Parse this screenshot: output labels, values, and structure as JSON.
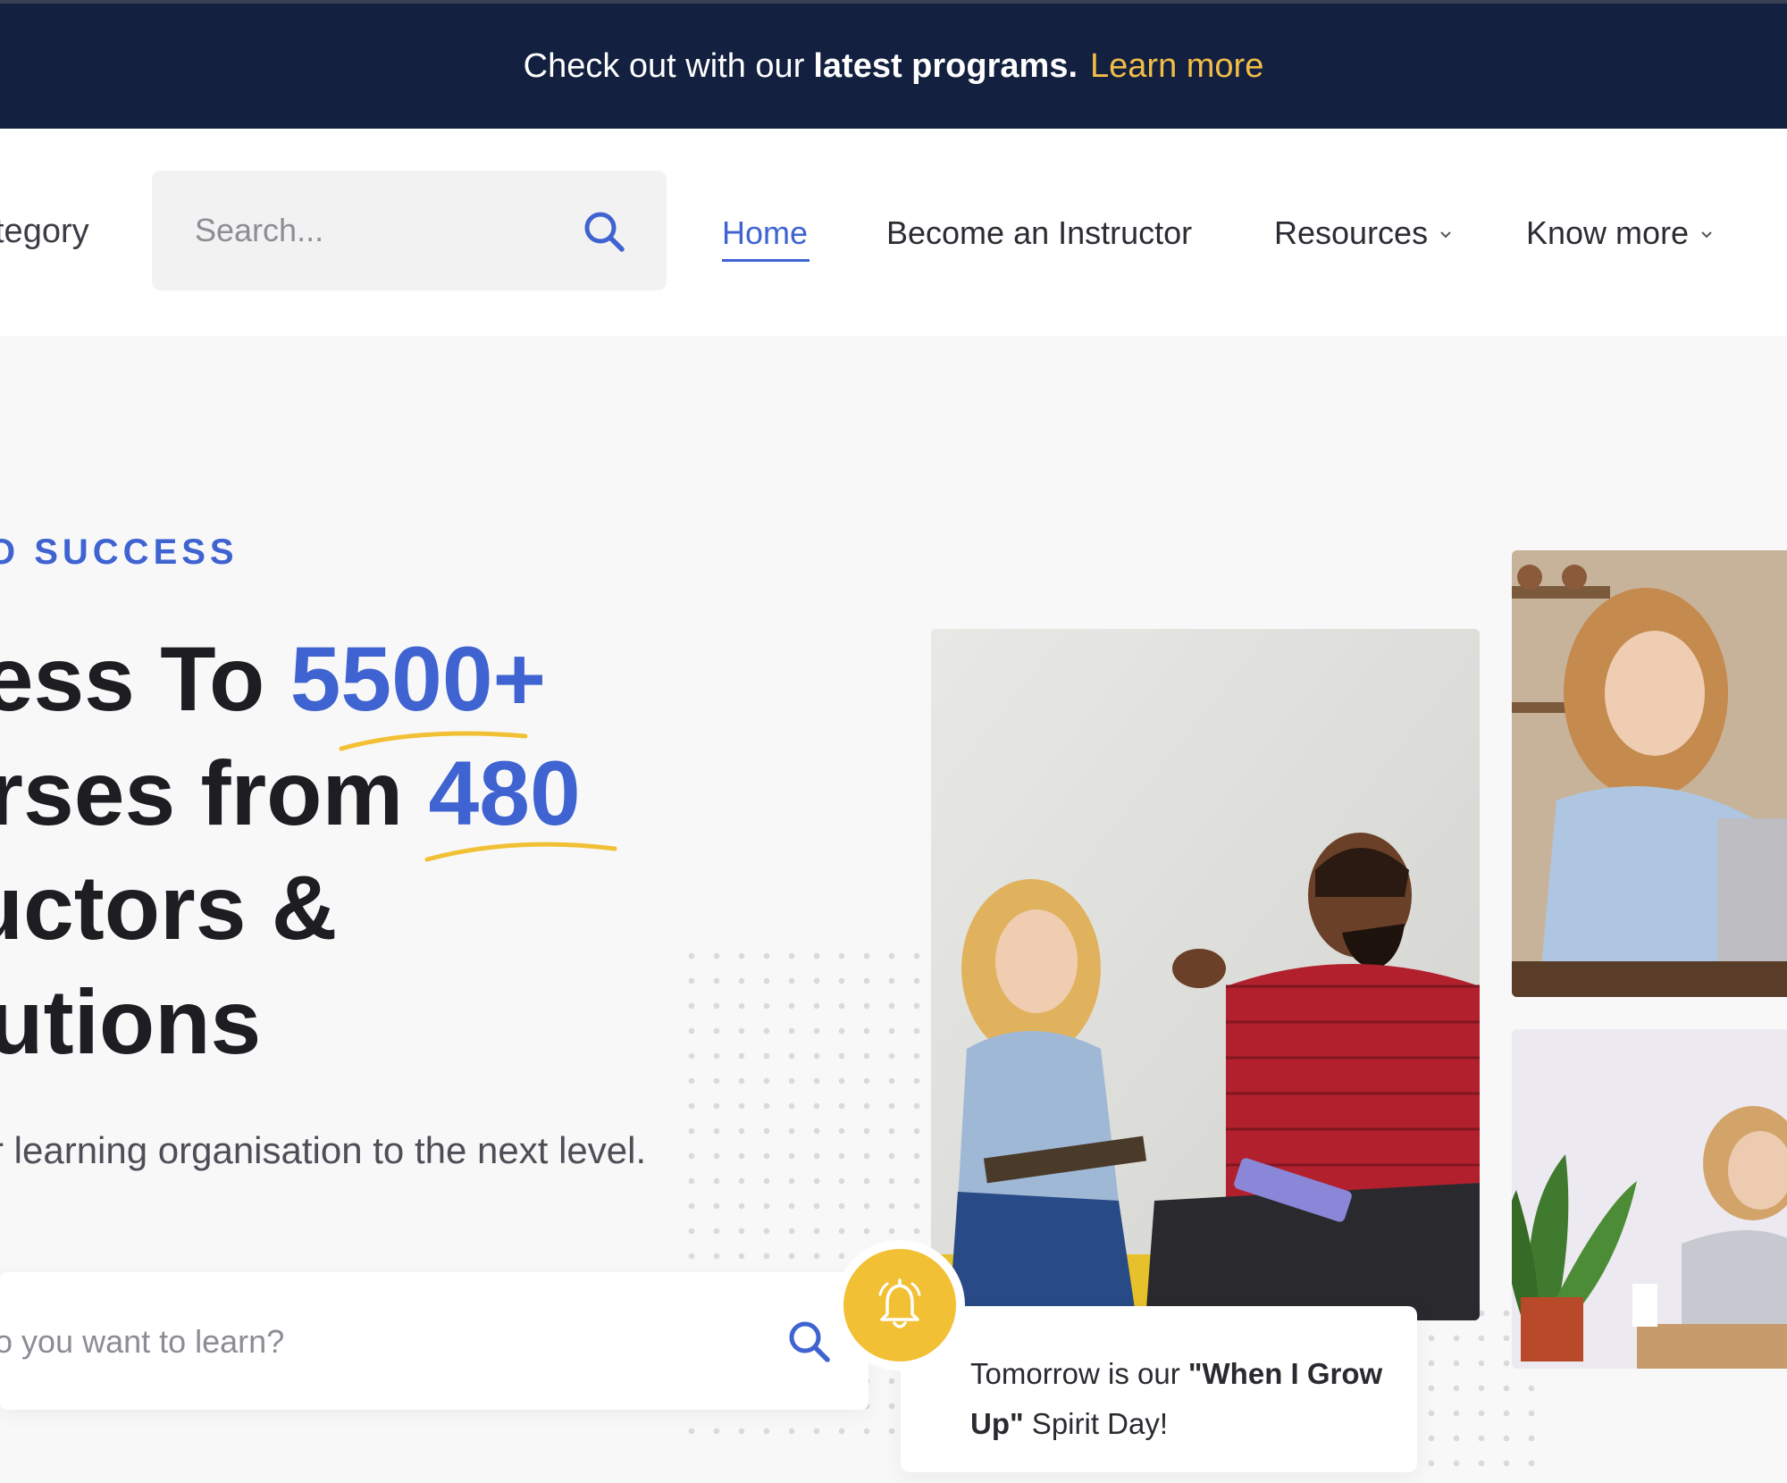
{
  "announcement": {
    "prefix": "Check out with our",
    "emphasis": "latest programs.",
    "link": "Learn more"
  },
  "navbar": {
    "category_label": "tegory",
    "search": {
      "placeholder": "Search..."
    },
    "items": [
      {
        "label": "Home",
        "active": true
      },
      {
        "label": "Become an Instructor"
      },
      {
        "label": "Resources"
      },
      {
        "label": "Know more"
      }
    ]
  },
  "hero": {
    "eyebrow": "O SUCCESS",
    "headline": {
      "line1_prefix": "cess To ",
      "line1_highlight": "5500+",
      "line2_prefix": "urses from ",
      "line2_highlight": "480",
      "line3": "ructors &",
      "line4": "itutions"
    },
    "subtext": "r learning organisation to the next level.",
    "search": {
      "placeholder": "o you want to learn?"
    },
    "notification": {
      "prefix": "Tomorrow is our ",
      "emphasis": "\"When I Grow Up\"",
      "suffix": " Spirit Day!"
    }
  },
  "colors": {
    "navy": "#13203f",
    "accent_blue": "#3f63d0",
    "accent_yellow": "#f2c034",
    "link_yellow": "#f2bd46"
  }
}
